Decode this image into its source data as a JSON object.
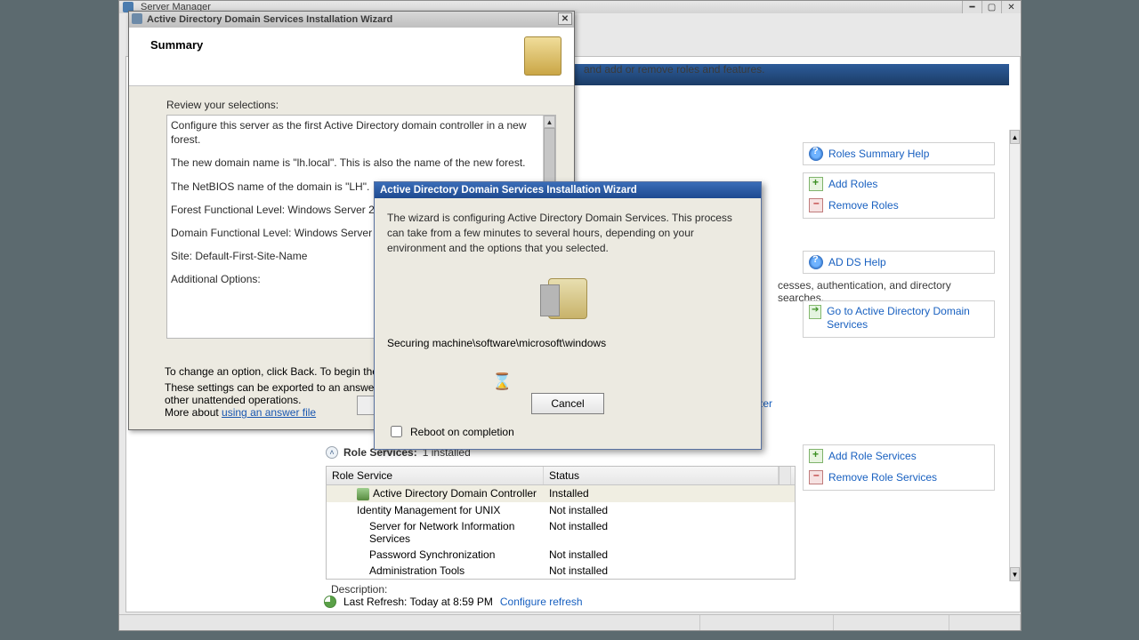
{
  "server_manager": {
    "window_title": "Server Manager",
    "description_tail": "and add or remove roles and features.",
    "roles_help": "Roles Summary Help",
    "add_roles": "Add Roles",
    "remove_roles": "Remove Roles",
    "adds_help": "AD DS Help",
    "adds_desc_tail": "cesses, authentication, and directory searches.",
    "go_adds": "Go to Active Directory Domain Services",
    "learn_link_tail": "zer",
    "add_role_services": "Add Role Services",
    "remove_role_services": "Remove Role Services",
    "role_services_caption": "Role Services:",
    "role_services_count": "1 installed",
    "col_role_service": "Role Service",
    "col_status": "Status",
    "rows": [
      {
        "name": "Active Directory Domain Controller",
        "status": "Installed",
        "indent": 1,
        "installed": true
      },
      {
        "name": "Identity Management for UNIX",
        "status": "Not installed",
        "indent": 1,
        "installed": false
      },
      {
        "name": "Server for Network Information Services",
        "status": "Not installed",
        "indent": 2,
        "installed": false
      },
      {
        "name": "Password Synchronization",
        "status": "Not installed",
        "indent": 2,
        "installed": false
      },
      {
        "name": "Administration Tools",
        "status": "Not installed",
        "indent": 2,
        "installed": false
      }
    ],
    "description_label": "Description:",
    "last_refresh": "Last Refresh: Today at 8:59 PM",
    "configure_refresh": "Configure refresh"
  },
  "summary_wizard": {
    "title": "Active Directory Domain Services Installation Wizard",
    "heading": "Summary",
    "review_label": "Review your selections:",
    "lines": {
      "l1": "Configure this server as the first Active Directory domain controller in a new forest.",
      "l2": "The new domain name is \"lh.local\". This is also the name of the new forest.",
      "l3": "The NetBIOS name of the domain is \"LH\".",
      "l4": "Forest Functional Level: Windows Server 2003",
      "l5": "Domain Functional Level: Windows Server 2003",
      "l6": "Site: Default-First-Site-Name",
      "l7": "Additional Options:"
    },
    "change_hint": "To change an option, click Back. To begin the op",
    "export_hint": "These settings can be exported to an answer file\nother unattended operations.\nMore about ",
    "answer_file_link": "using an answer file"
  },
  "progress_dialog": {
    "title": "Active Directory Domain Services Installation Wizard",
    "message": "The wizard is configuring Active Directory Domain Services. This process can take from a few minutes to several hours, depending on your environment and the options that you selected.",
    "status": "Securing machine\\software\\microsoft\\windows",
    "cancel": "Cancel",
    "reboot": "Reboot on completion"
  }
}
